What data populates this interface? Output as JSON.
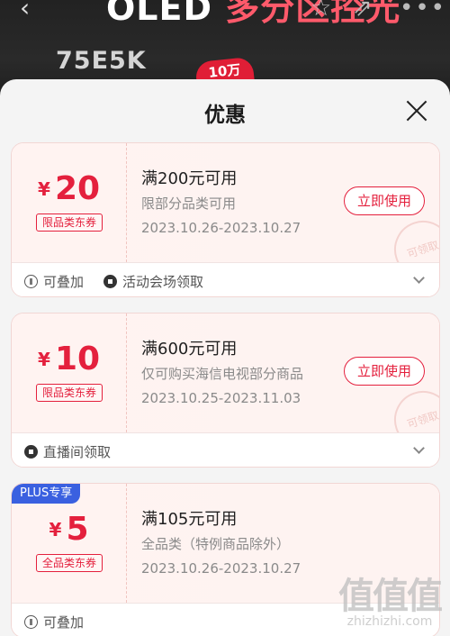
{
  "background": {
    "back_icon": "‹",
    "banner_title_a": "OLED",
    "banner_title_b": "多分区控光",
    "model": "75E5K",
    "badge": "10万",
    "star_icon": "☆",
    "share_icon": "⇗",
    "more_icon": "•••"
  },
  "sheet": {
    "title": "优惠",
    "close_icon": "close-icon"
  },
  "coupons": [
    {
      "currency": "¥",
      "amount": "20",
      "type_tag": "限品类东券",
      "condition": "满200元可用",
      "scope": "限部分品类可用",
      "date": "2023.10.26-2023.10.27",
      "button": "立即使用",
      "stamp": "可领取",
      "foot_a": "可叠加",
      "foot_b": "活动会场领取"
    },
    {
      "currency": "¥",
      "amount": "10",
      "type_tag": "限品类东券",
      "condition": "满600元可用",
      "scope": "仅可购买海信电视部分商品",
      "date": "2023.10.25-2023.11.03",
      "button": "立即使用",
      "stamp": "可领取",
      "foot_a": "直播间领取"
    },
    {
      "plus_tag": "PLUS专享",
      "currency": "¥",
      "amount": "5",
      "type_tag": "全品类东券",
      "condition": "满105元可用",
      "scope": "全品类（特例商品除外）",
      "date": "2023.10.26-2023.10.27",
      "foot_a": "可叠加"
    }
  ],
  "watermark": {
    "logo": "值值值",
    "url": "zhizhizhi.com"
  },
  "colors": {
    "accent_red": "#e4203d",
    "plus_blue": "#3a60e0"
  }
}
